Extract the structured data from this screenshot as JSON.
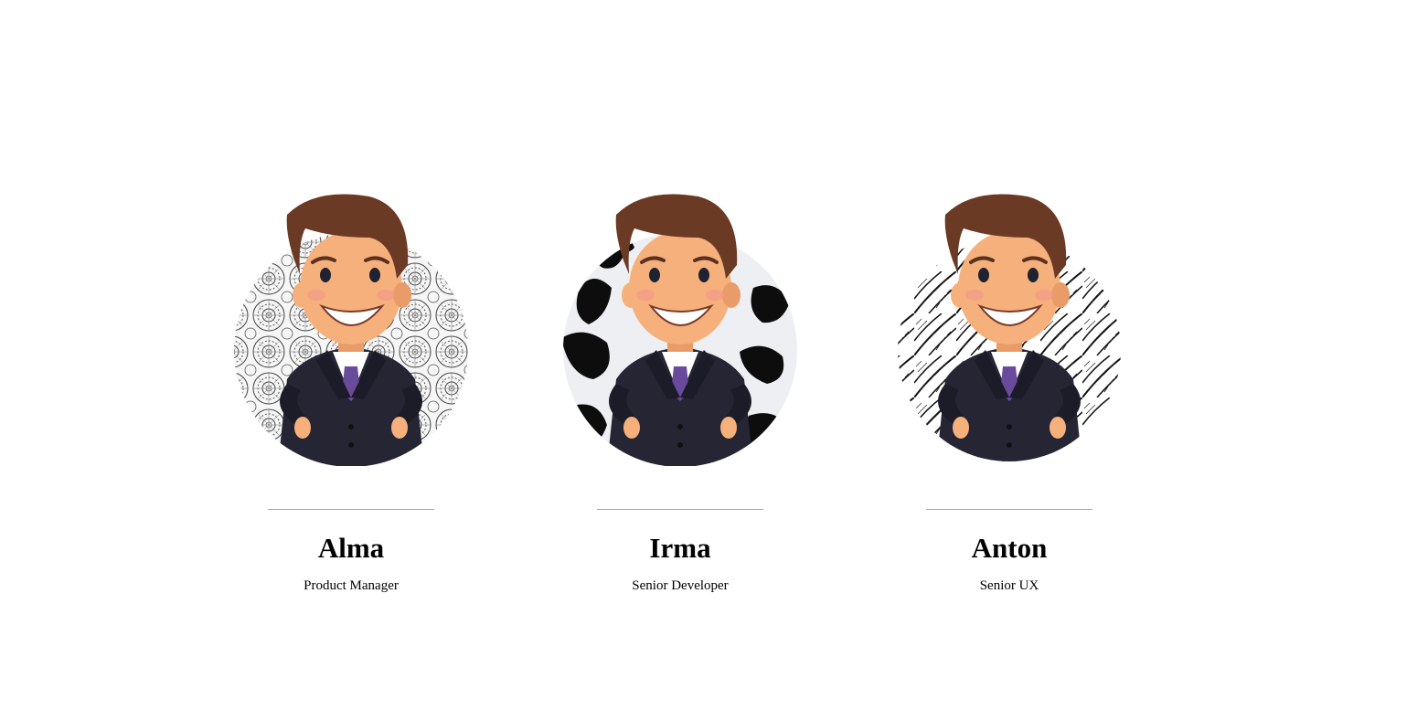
{
  "team": {
    "members": [
      {
        "name": "Alma",
        "role": "Product Manager",
        "background": "mandala-pattern"
      },
      {
        "name": "Irma",
        "role": "Senior Developer",
        "background": "cow-spots-pattern"
      },
      {
        "name": "Anton",
        "role": "Senior UX",
        "background": "zentangle-pattern"
      }
    ]
  },
  "colors": {
    "hair": "#6b3a24",
    "skin": "#f6b07c",
    "suit": "#252534",
    "tie": "#6a4b9b",
    "divider": "#a8a8a8"
  }
}
